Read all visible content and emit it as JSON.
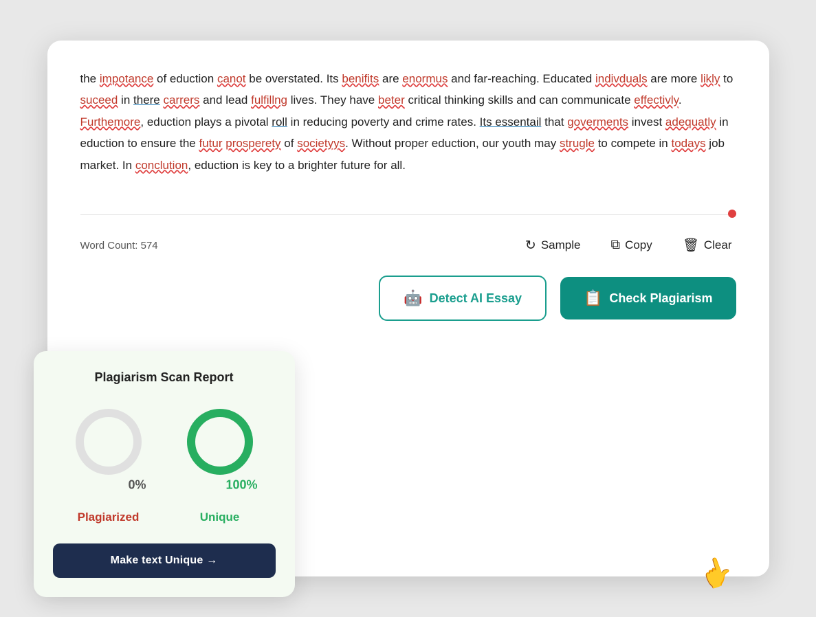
{
  "text": {
    "paragraph": "the impotance of eduction canot be overstated. Its benifits are enormus and far-reaching. Educated indivduals are more likly to suceed in there carrers and lead fulfillng lives. They have beter critical thinking skills and can communicate effectivly. Furthemore, eduction plays a pivotal roll in reducing poverty and crime rates. Its essentail that goverments invest adequatly in eduction to ensure the futur prosperety of societyys. Without proper eduction, our youth may strugle to compete in todays job market. In conclution, eduction is key to a brighter future for all.",
    "segments": [
      {
        "text": "the",
        "type": "normal"
      },
      {
        "text": " "
      },
      {
        "text": "impotance",
        "type": "misspelled"
      },
      {
        "text": " of eduction "
      },
      {
        "text": "canot",
        "type": "misspelled"
      },
      {
        "text": " be overstated. Its "
      },
      {
        "text": "benifits",
        "type": "misspelled"
      },
      {
        "text": " are "
      },
      {
        "text": "enormus",
        "type": "misspelled"
      },
      {
        "text": " and far-reaching. Educated "
      },
      {
        "text": "indivduals",
        "type": "misspelled"
      },
      {
        "text": " are more "
      },
      {
        "text": "likly",
        "type": "misspelled"
      },
      {
        "text": " to "
      },
      {
        "text": "suceed",
        "type": "misspelled"
      },
      {
        "text": " in "
      },
      {
        "text": "there",
        "type": "grammar"
      },
      {
        "text": " "
      },
      {
        "text": "carrers",
        "type": "misspelled"
      },
      {
        "text": " and lead "
      },
      {
        "text": "fulfillng",
        "type": "misspelled"
      },
      {
        "text": " lives. They have "
      },
      {
        "text": "beter",
        "type": "misspelled"
      },
      {
        "text": " critical thinking skills and can communicate "
      },
      {
        "text": "effectivly",
        "type": "misspelled"
      },
      {
        "text": ". "
      },
      {
        "text": "Furthemore",
        "type": "misspelled"
      },
      {
        "text": ", eduction plays a pivotal "
      },
      {
        "text": "roll",
        "type": "grammar"
      },
      {
        "text": " in reducing poverty and crime rates. "
      },
      {
        "text": "Its essentail",
        "type": "grammar"
      },
      {
        "text": " that "
      },
      {
        "text": "goverments",
        "type": "misspelled"
      },
      {
        "text": " invest "
      },
      {
        "text": "adequatly",
        "type": "misspelled"
      },
      {
        "text": " in eduction to ensure the "
      },
      {
        "text": "futur",
        "type": "misspelled"
      },
      {
        "text": " "
      },
      {
        "text": "prosperety",
        "type": "misspelled"
      },
      {
        "text": " of "
      },
      {
        "text": "societyys",
        "type": "misspelled"
      },
      {
        "text": ". Without proper eduction, our youth may "
      },
      {
        "text": "strugle",
        "type": "misspelled"
      },
      {
        "text": " to compete in "
      },
      {
        "text": "todays",
        "type": "misspelled"
      },
      {
        "text": " job market. In "
      },
      {
        "text": "conclution",
        "type": "misspelled"
      },
      {
        "text": ", eduction is key to a brighter future for all."
      }
    ]
  },
  "toolbar": {
    "word_count_label": "Word Count: 574",
    "sample_label": "Sample",
    "copy_label": "Copy",
    "clear_label": "Clear"
  },
  "actions": {
    "detect_ai_label": "Detect AI Essay",
    "check_plagiarism_label": "Check Plagiarism"
  },
  "plagiarism_report": {
    "title": "Plagiarism Scan Report",
    "plagiarized_pct": "0%",
    "unique_pct": "100%",
    "plagiarized_label": "Plagiarized",
    "unique_label": "Unique",
    "make_unique_label": "Make text Unique →"
  }
}
